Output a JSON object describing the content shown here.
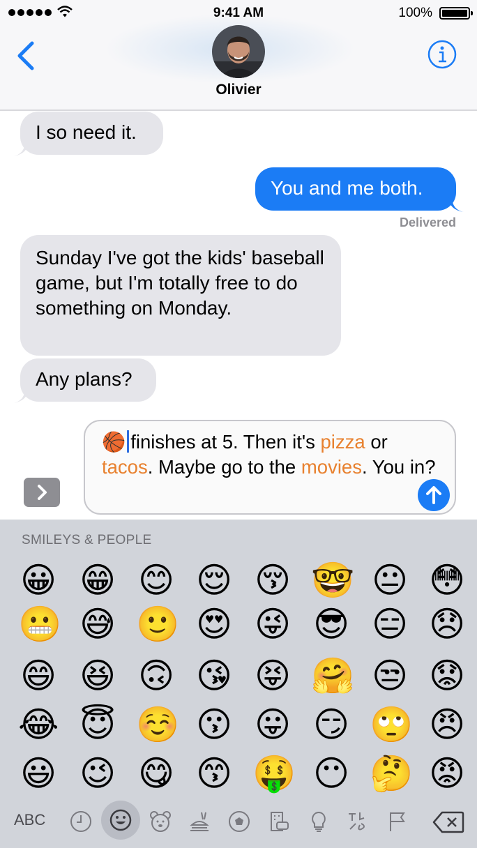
{
  "status_bar": {
    "time": "9:41 AM",
    "battery_percent": "100%",
    "signal_dots": 5
  },
  "header": {
    "back_icon": "chevron-left-icon",
    "contact_name": "Olivier",
    "info_icon": "info-icon",
    "accent_color": "#1b7cf5"
  },
  "messages": [
    {
      "direction": "incoming",
      "text": "I so need it."
    },
    {
      "direction": "outgoing",
      "text": "You and me both."
    },
    {
      "direction": "incoming",
      "text": "Sunday I've got the kids' baseball game, but I'm totally free to do something on Monday."
    },
    {
      "direction": "incoming",
      "text": "Any plans?"
    }
  ],
  "delivery_status": "Delivered",
  "compose": {
    "emoji": "🏀",
    "segments": [
      {
        "text": "finishes at 5. Then it's ",
        "highlight": false
      },
      {
        "text": "pizza",
        "highlight": true
      },
      {
        "text": " or ",
        "highlight": false
      },
      {
        "text": "tacos",
        "highlight": true
      },
      {
        "text": ". Maybe go to the ",
        "highlight": false
      },
      {
        "text": "movies",
        "highlight": true
      },
      {
        "text": ". You in?",
        "highlight": false
      }
    ],
    "highlight_color": "#e8812f",
    "send_icon": "arrow-up-icon",
    "expand_icon": "chevron-right-icon"
  },
  "keyboard": {
    "section_title": "SMILEYS & PEOPLE",
    "emoji_rows": [
      [
        "😀",
        "😁",
        "😊",
        "😌",
        "😚",
        "🤓",
        "😐",
        "😳"
      ],
      [
        "😬",
        "😅",
        "🙂",
        "😍",
        "😜",
        "😎",
        "😑",
        "😞"
      ],
      [
        "😄",
        "😆",
        "🙃",
        "😘",
        "😝",
        "🤗",
        "😒",
        "😟"
      ],
      [
        "😂",
        "😇",
        "☺️",
        "😗",
        "😛",
        "😏",
        "🙄",
        "😠"
      ],
      [
        "😃",
        "😉",
        "😋",
        "😙",
        "🤑",
        "😶",
        "🤔",
        "😡"
      ]
    ],
    "abc_label": "ABC",
    "categories": [
      "clock-icon",
      "smiley-icon",
      "bear-icon",
      "food-icon",
      "ball-icon",
      "building-icon",
      "lightbulb-icon",
      "symbols-icon",
      "flag-icon"
    ],
    "selected_category": "smiley-icon",
    "backspace_icon": "backspace-icon"
  }
}
